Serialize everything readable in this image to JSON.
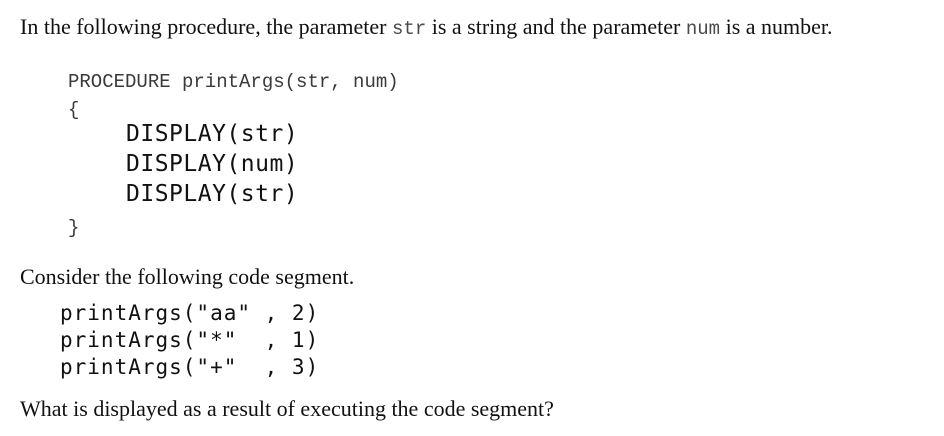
{
  "intro": {
    "text_1": "In the following procedure, the parameter ",
    "code_1": "str",
    "text_2": " is a string and the parameter ",
    "code_2": "num",
    "text_3": " is a number."
  },
  "procedure": {
    "header": "PROCEDURE printArgs(str, num)",
    "open_brace": "{",
    "body_lines": [
      "DISPLAY(str)",
      "DISPLAY(num)",
      "DISPLAY(str)"
    ],
    "close_brace": "}"
  },
  "consider": "Consider the following code segment.",
  "segment_lines": [
    "printArgs(\"aa\" , 2)",
    "printArgs(\"*\"  , 1)",
    "printArgs(\"+\"  , 3)"
  ],
  "question": "What is displayed as a result of executing the code segment?"
}
